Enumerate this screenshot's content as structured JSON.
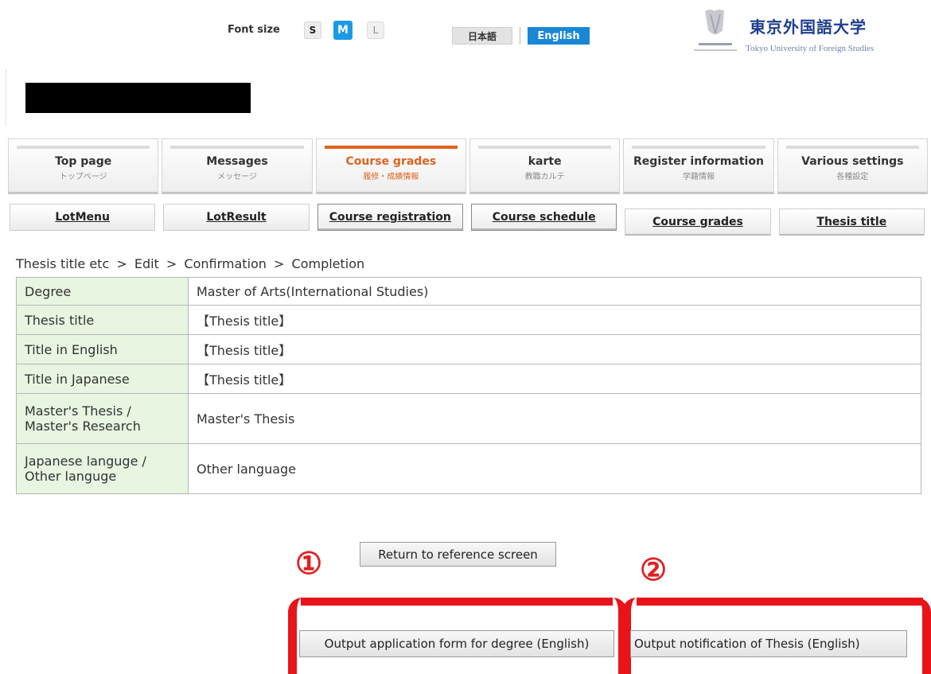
{
  "header": {
    "font_size_label": "Font size",
    "font_sizes": [
      "S",
      "M",
      "L"
    ],
    "lang_japanese": "日本語",
    "lang_english": "English",
    "university_name_ja": "東京外国語大学",
    "university_name_en": "Tokyo University of Foreign Studies",
    "logo_icon": "university-emblem-icon"
  },
  "main_nav": [
    {
      "en": "Top page",
      "ja": "トップページ"
    },
    {
      "en": "Messages",
      "ja": "メッセージ"
    },
    {
      "en": "Course grades",
      "ja": "履修・成績情報",
      "active": true
    },
    {
      "en": "karte",
      "ja": "教職カルテ"
    },
    {
      "en": "Register information",
      "ja": "学籍情報"
    },
    {
      "en": "Various settings",
      "ja": "各種設定"
    }
  ],
  "sub_nav": [
    "LotMenu",
    "LotResult",
    "Course registration",
    "Course schedule",
    "Course grades",
    "Thesis title"
  ],
  "breadcrumb": [
    "Thesis title etc",
    ">",
    "Edit",
    ">",
    "Confirmation",
    ">",
    "Completion"
  ],
  "table": {
    "rows": [
      {
        "label": "Degree",
        "value": "Master of Arts(International Studies)"
      },
      {
        "label": "Thesis title",
        "value": "【Thesis title】"
      },
      {
        "label": "Title in English",
        "value": "【Thesis title】"
      },
      {
        "label": "Title in Japanese",
        "value": "【Thesis title】"
      },
      {
        "label": "Master's Thesis /\nMaster's Research",
        "value": "Master's Thesis"
      },
      {
        "label": "Japanese languge /\nOther languge",
        "value": "Other language"
      }
    ]
  },
  "actions": {
    "return_label": "Return to reference screen",
    "output_degree_label": "Output application form for degree (English)",
    "output_thesis_label": "Output notification of Thesis (English)"
  },
  "annotations": {
    "marker_1": "①",
    "marker_2": "②",
    "highlight_color": "#e8141a"
  },
  "colors": {
    "accent_blue": "#1a87d6",
    "active_tab_orange": "#e0621e",
    "table_label_bg": "#e7f5e1"
  }
}
